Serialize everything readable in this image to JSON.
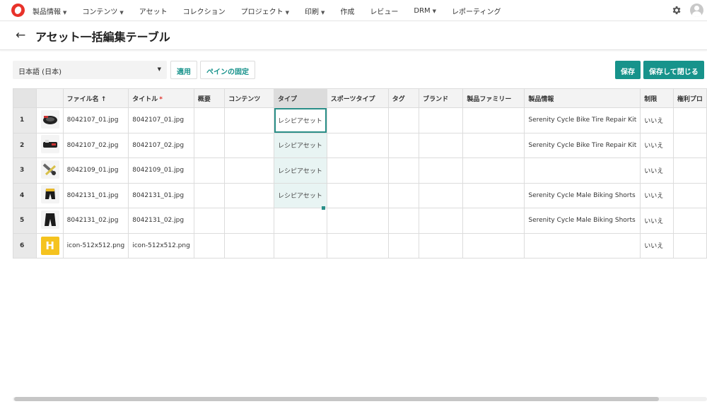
{
  "nav": {
    "items": [
      {
        "label": "製品情報",
        "caret": true
      },
      {
        "label": "コンテンツ",
        "caret": true
      },
      {
        "label": "アセット",
        "caret": false
      },
      {
        "label": "コレクション",
        "caret": false
      },
      {
        "label": "プロジェクト",
        "caret": true
      },
      {
        "label": "印刷",
        "caret": true
      },
      {
        "label": "作成",
        "caret": false
      },
      {
        "label": "レビュー",
        "caret": false
      },
      {
        "label": "DRM",
        "caret": true
      },
      {
        "label": "レポーティング",
        "caret": false
      }
    ]
  },
  "header": {
    "title": "アセット一括編集テーブル"
  },
  "toolbar": {
    "language": "日本語 (日本)",
    "apply_label": "適用",
    "freeze_label": "ペインの固定",
    "save_label": "保存",
    "save_close_label": "保存して閉じる"
  },
  "table": {
    "columns": [
      "",
      "",
      "ファイル名 ↑",
      "タイトル",
      "概要",
      "コンテンツ",
      "タイプ",
      "スポーツタイプ",
      "タグ",
      "ブランド",
      "製品ファミリー",
      "製品情報",
      "制限",
      "権利プロ"
    ],
    "title_required_mark": "*",
    "rows": [
      {
        "num": "1",
        "thumb": "black-tire-kit",
        "filename": "8042107_01.jpg",
        "title": "8042107_01.jpg",
        "type": "レシピアセット",
        "product": "Serenity Cycle Bike Tire Repair Kit",
        "restriction": "いいえ"
      },
      {
        "num": "2",
        "thumb": "tire-kit-open",
        "filename": "8042107_02.jpg",
        "title": "8042107_02.jpg",
        "type": "レシピアセット",
        "product": "Serenity Cycle Bike Tire Repair Kit",
        "restriction": "いいえ"
      },
      {
        "num": "3",
        "thumb": "bike-tool",
        "filename": "8042109_01.jpg",
        "title": "8042109_01.jpg",
        "type": "レシピアセット",
        "product": "",
        "restriction": "いいえ"
      },
      {
        "num": "4",
        "thumb": "yellow-shorts",
        "filename": "8042131_01.jpg",
        "title": "8042131_01.jpg",
        "type": "レシピアセット",
        "product": "Serenity Cycle Male Biking Shorts",
        "restriction": "いいえ"
      },
      {
        "num": "5",
        "thumb": "black-shorts",
        "filename": "8042131_02.jpg",
        "title": "8042131_02.jpg",
        "type": "",
        "product": "Serenity Cycle Male Biking Shorts",
        "restriction": "いいえ"
      },
      {
        "num": "6",
        "thumb": "h-icon",
        "filename": "icon-512x512.png",
        "title": "icon-512x512.png",
        "type": "",
        "product": "",
        "restriction": "いいえ"
      }
    ],
    "h_icon_letter": "H"
  },
  "colors": {
    "accent": "#17938b",
    "logo": "#e8322a",
    "h_icon": "#f5c31f"
  }
}
